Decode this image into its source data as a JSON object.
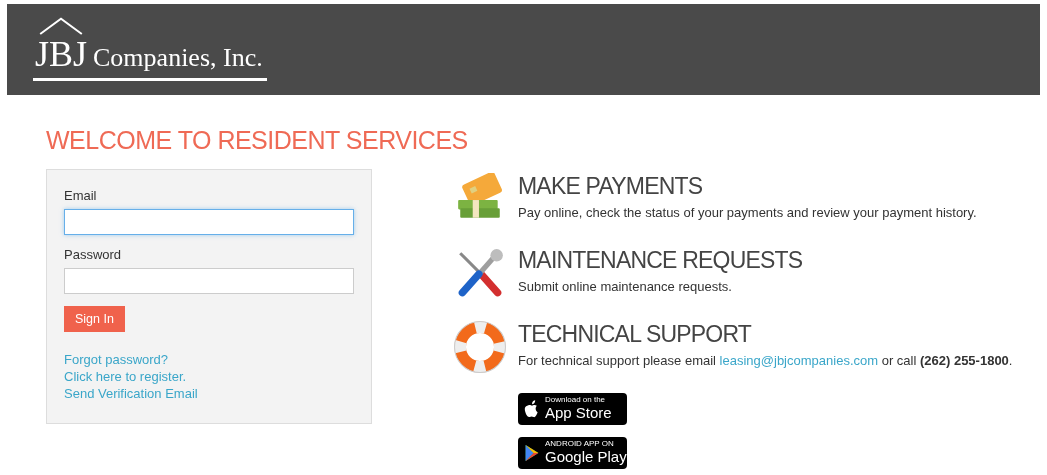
{
  "header": {
    "logo_mark": "JBJ",
    "logo_text": "Companies, Inc."
  },
  "page_title": "WELCOME TO RESIDENT SERVICES",
  "login": {
    "fields": [
      {
        "label": "Email",
        "focused": true
      },
      {
        "label": "Password",
        "focused": false
      }
    ],
    "submit": "Sign In",
    "links": [
      "Forgot password?",
      "Click here to register.",
      "Send Verification Email"
    ]
  },
  "features": [
    {
      "kind": "payments",
      "title": "MAKE PAYMENTS",
      "description": "Pay online, check the status of your payments and review your payment history."
    },
    {
      "kind": "maintenance",
      "title": "MAINTENANCE REQUESTS",
      "description": "Submit online maintenance requests."
    },
    {
      "kind": "support",
      "title": "TECHNICAL SUPPORT",
      "description": "For technical support please email ",
      "link": "leasing@jbjcompanies.com",
      "description_end": " or call **(262) 255-1800**."
    }
  ],
  "app_badges": [
    {
      "kind": "apple",
      "small": "Download on the",
      "large": "App Store"
    },
    {
      "kind": "google",
      "small": "ANDROID APP ON",
      "large": "Google Play"
    }
  ]
}
